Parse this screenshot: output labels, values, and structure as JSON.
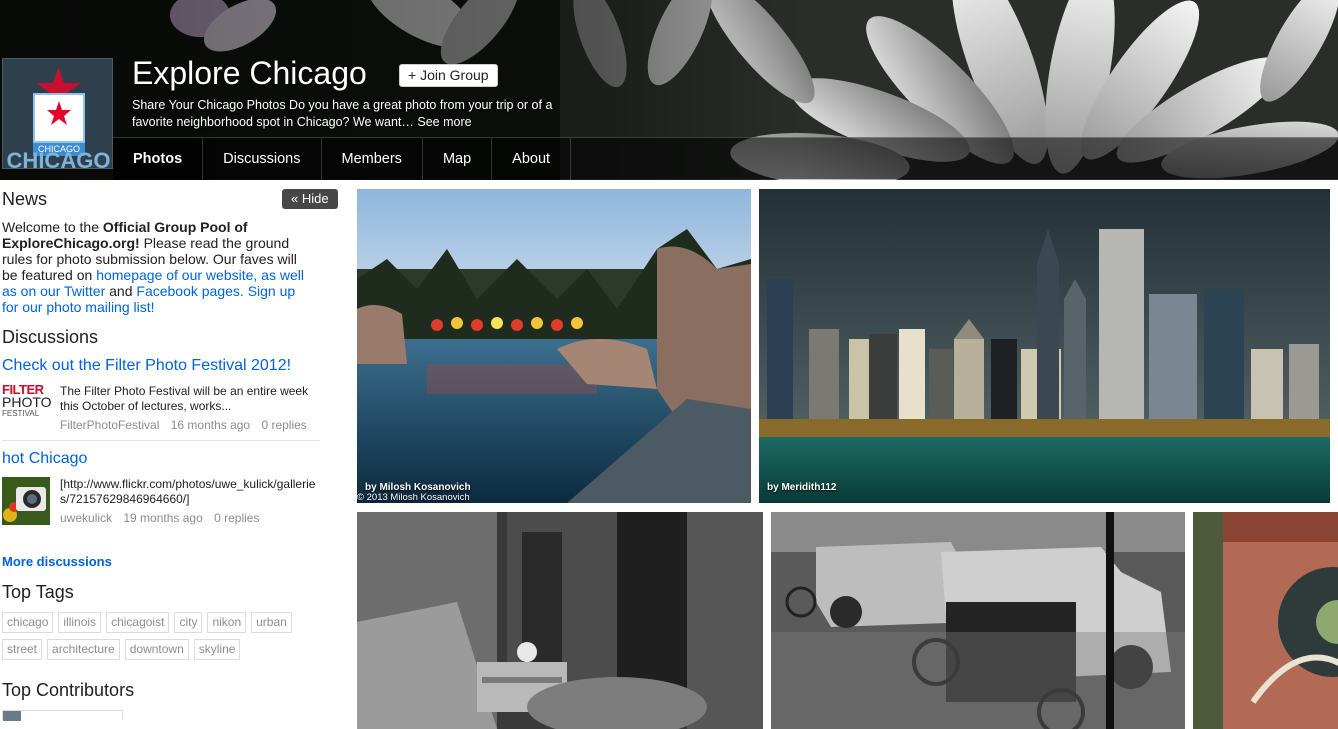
{
  "group": {
    "title": "Explore Chicago",
    "join_label": "+ Join Group",
    "description": "Share Your Chicago Photos Do you have a great photo from your trip or of a favorite neighborhood spot in Chicago? We want…",
    "see_more": "See more",
    "avatar_small_text": "CHICAGO",
    "avatar_big_text": "CHICAGO"
  },
  "tabs": [
    {
      "label": "Photos",
      "active": true
    },
    {
      "label": "Discussions",
      "active": false
    },
    {
      "label": "Members",
      "active": false
    },
    {
      "label": "Map",
      "active": false
    },
    {
      "label": "About",
      "active": false
    }
  ],
  "news": {
    "title": "News",
    "hide_label": "Hide",
    "text_1": "Welcome to the ",
    "text_bold": "Official Group Pool of ExploreChicago.org!",
    "text_2": " Please read the ground rules for photo submission below. Our faves will be featured on ",
    "link_1": "homepage of our website, as well as on our Twitter",
    "text_3": " and ",
    "link_2": "Facebook pages.",
    "text_4": " ",
    "link_3": "Sign up for our photo mailing list!"
  },
  "discussions": {
    "title": "Discussions",
    "items": [
      {
        "title": "Check out the Filter Photo Festival 2012!",
        "body": "The Filter Photo Festival will be an entire week this October of lectures, works...",
        "author": "FilterPhotoFestival",
        "age": "16 months ago",
        "replies": "0 replies",
        "thumb_text_1": "FILTER",
        "thumb_text_2": "PHOTO",
        "thumb_text_3": "FESTIVAL"
      },
      {
        "title": "hot Chicago",
        "body": "[http://www.flickr.com/photos/uwe_kulick/galleries/72157629846964660/]",
        "author": "uwekulick",
        "age": "19 months ago",
        "replies": "0 replies"
      }
    ],
    "more_label": "More discussions"
  },
  "tags": {
    "title": "Top Tags",
    "items": [
      "chicago",
      "illinois",
      "chicagoist",
      "city",
      "nikon",
      "urban",
      "street",
      "architecture",
      "downtown",
      "skyline"
    ]
  },
  "contributors": {
    "title": "Top Contributors"
  },
  "photos": [
    {
      "credit": "by Milosh Kosanovich",
      "copyright": "© 2013 Milosh Kosanovich"
    },
    {
      "credit": "by Meridith112"
    },
    {
      "credit": ""
    },
    {
      "credit": ""
    },
    {
      "credit": ""
    }
  ],
  "colors": {
    "link": "#0063dc",
    "text": "#212124",
    "meta": "#8d8d8d",
    "hide_button": "#474747"
  }
}
